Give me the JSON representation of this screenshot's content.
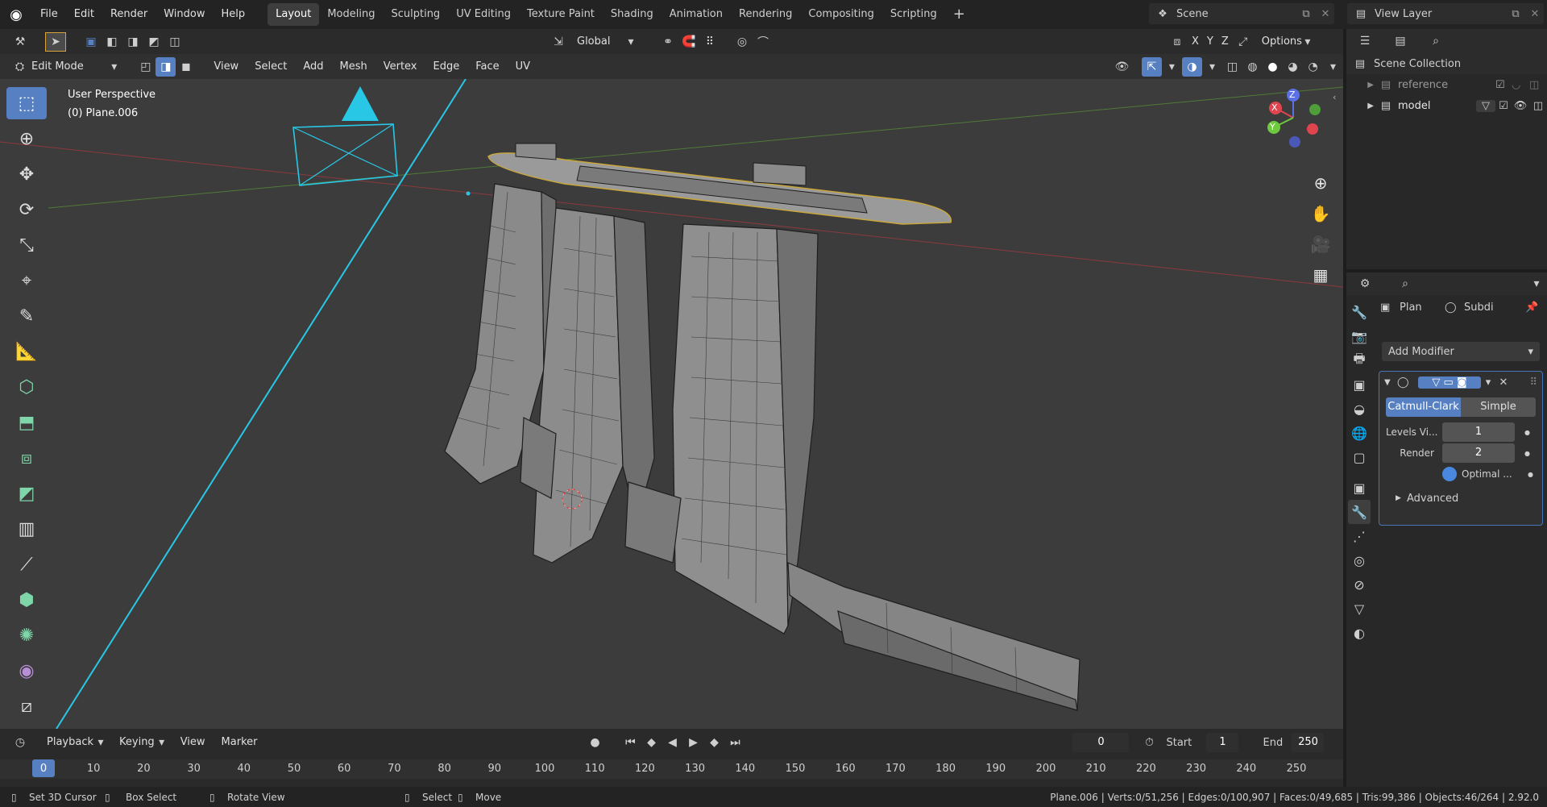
{
  "topbar": {
    "menu": [
      "File",
      "Edit",
      "Render",
      "Window",
      "Help"
    ],
    "workspaces": [
      "Layout",
      "Modeling",
      "Sculpting",
      "UV Editing",
      "Texture Paint",
      "Shading",
      "Animation",
      "Rendering",
      "Compositing",
      "Scripting"
    ],
    "add_tab": "+",
    "scene": "Scene",
    "view_layer": "View Layer"
  },
  "tool_header": {
    "orientation": "Global",
    "axes": [
      "X",
      "Y",
      "Z"
    ],
    "options": "Options"
  },
  "view_header": {
    "mode": "Edit Mode",
    "menus": [
      "View",
      "Select",
      "Add",
      "Mesh",
      "Vertex",
      "Edge",
      "Face",
      "UV"
    ]
  },
  "viewport": {
    "perspective": "User Perspective",
    "object": "(0) Plane.006",
    "gizmo_axes": [
      "X",
      "Y",
      "Z"
    ]
  },
  "outliner": {
    "root": "Scene Collection",
    "items": [
      {
        "name": "reference"
      },
      {
        "name": "model"
      }
    ]
  },
  "properties": {
    "breadcrumb": [
      "Plan",
      "Subdi"
    ],
    "add_modifier": "Add Modifier",
    "modes": [
      "Catmull-Clark",
      "Simple"
    ],
    "levels_label": "Levels Vi...",
    "levels_value": "1",
    "render_label": "Render",
    "render_value": "2",
    "optimal": "Optimal ...",
    "advanced": "Advanced"
  },
  "timeline": {
    "menus": [
      "Playback",
      "Keying",
      "View",
      "Marker"
    ],
    "current_frame": "0",
    "start_label": "Start",
    "start_value": "1",
    "end_label": "End",
    "end_value": "250",
    "ticks": [
      "0",
      "10",
      "20",
      "30",
      "40",
      "50",
      "60",
      "70",
      "80",
      "90",
      "100",
      "110",
      "120",
      "130",
      "140",
      "150",
      "160",
      "170",
      "180",
      "190",
      "200",
      "210",
      "220",
      "230",
      "240",
      "250"
    ]
  },
  "statusbar": {
    "hints": [
      "Set 3D Cursor",
      "Box Select",
      "Rotate View",
      "Select",
      "Move"
    ],
    "stats": "Plane.006 | Verts:0/51,256 | Edges:0/100,907 | Faces:0/49,685 | Tris:99,386 | Objects:46/264 | 2.92.0"
  },
  "colors": {
    "accent": "#5680c2",
    "camera": "#29c7e6",
    "axis_x": "#e0454f",
    "axis_y": "#6ec93f",
    "axis_z": "#5b6fe6"
  }
}
